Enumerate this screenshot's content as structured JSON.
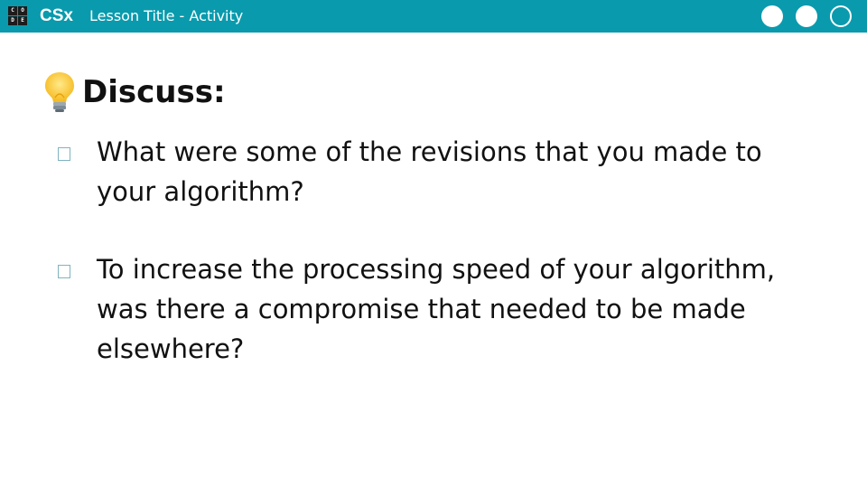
{
  "header": {
    "logo_letters": [
      "C",
      "O",
      "D",
      "E"
    ],
    "brand": "CSx",
    "lesson_title": "Lesson Title - Activity",
    "progress_dots": [
      "filled",
      "filled",
      "outline"
    ]
  },
  "slide": {
    "heading_icon": "lightbulb-icon",
    "heading": "Discuss:",
    "questions": [
      "What were some of the revisions that you made to your algorithm?",
      "To increase the processing speed of your algorithm, was there a compromise that needed to be made elsewhere?"
    ]
  },
  "colors": {
    "topbar": "#0a9aad",
    "text": "#111111",
    "checkbox_border": "#7fb4bf"
  }
}
